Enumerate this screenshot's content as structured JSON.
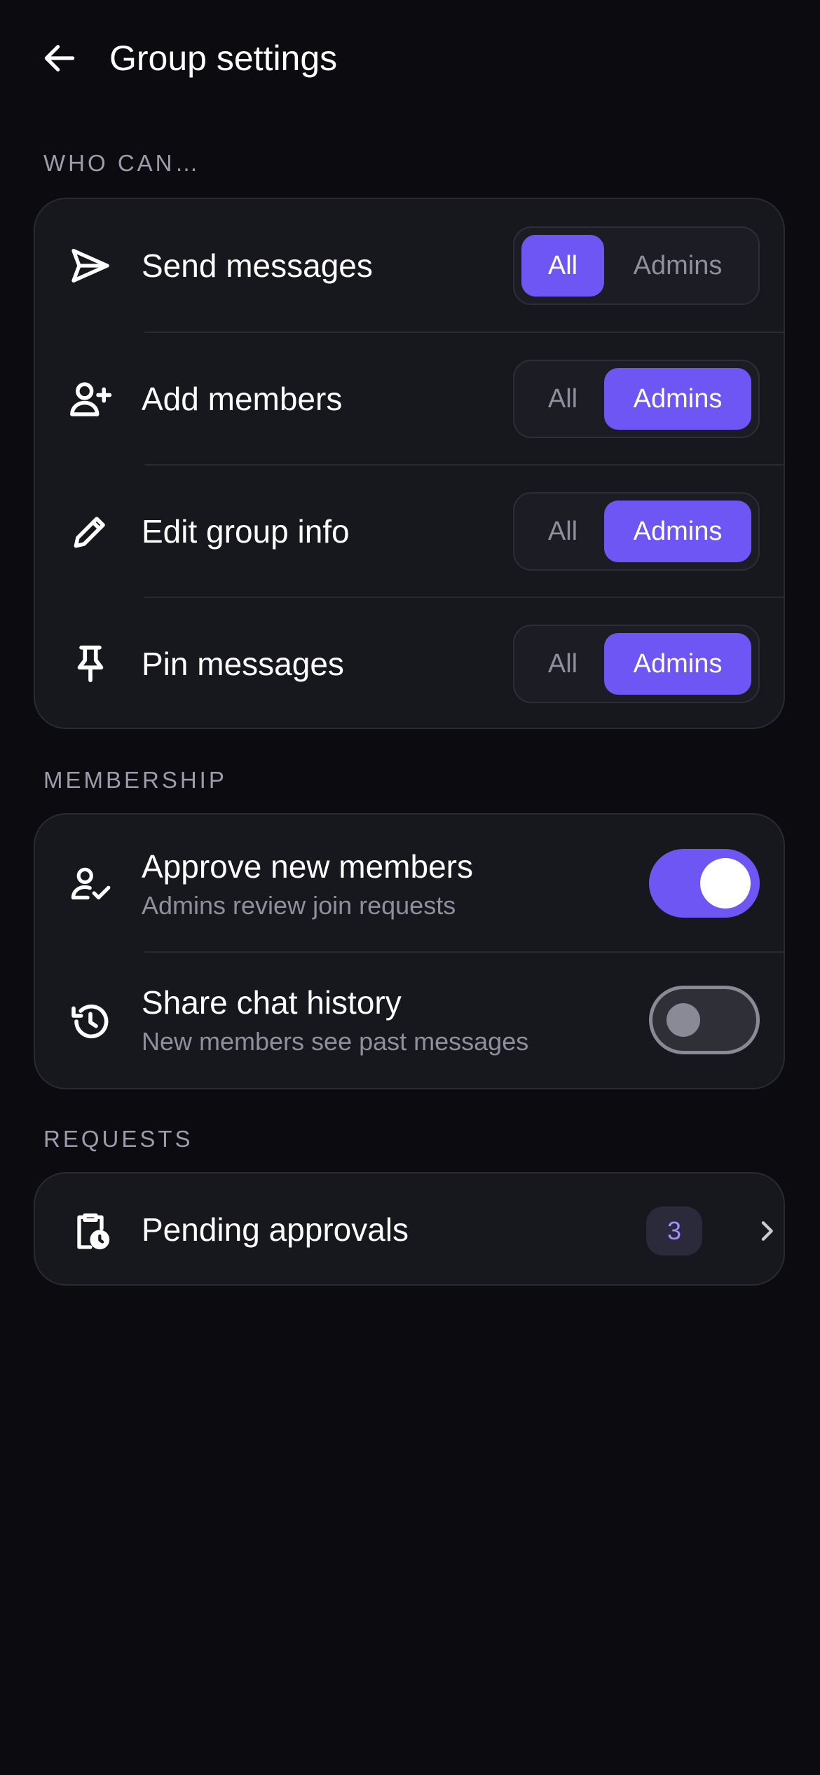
{
  "header": {
    "title": "Group settings",
    "back_icon": "arrow-left-icon"
  },
  "sections": {
    "who_can": "WHO CAN…",
    "membership": "MEMBERSHIP",
    "requests": "REQUESTS"
  },
  "permissions": [
    {
      "label": "Send messages",
      "icon": "send-icon",
      "all_label": "All",
      "admins_label": "Admins",
      "selected": "All"
    },
    {
      "label": "Add members",
      "icon": "person-add-icon",
      "all_label": "All",
      "admins_label": "Admins",
      "selected": "Admins"
    },
    {
      "label": "Edit group info",
      "icon": "pencil-icon",
      "all_label": "All",
      "admins_label": "Admins",
      "selected": "Admins"
    },
    {
      "label": "Pin messages",
      "icon": "pin-icon",
      "all_label": "All",
      "admins_label": "Admins",
      "selected": "Admins"
    }
  ],
  "membership": [
    {
      "label": "Approve new members",
      "sublabel": "Admins review join requests",
      "icon": "person-check-icon",
      "enabled": true
    },
    {
      "label": "Share chat history",
      "sublabel": "New members see past messages",
      "icon": "history-icon",
      "enabled": false
    }
  ],
  "requests": {
    "label": "Pending approvals",
    "count": "3",
    "icon": "clipboard-clock-icon"
  },
  "colors": {
    "accent": "#6e56f4",
    "background": "#0b0b10",
    "card": "#17171e",
    "muted_text": "#8f8f9e",
    "badge_text": "#a38cff"
  }
}
